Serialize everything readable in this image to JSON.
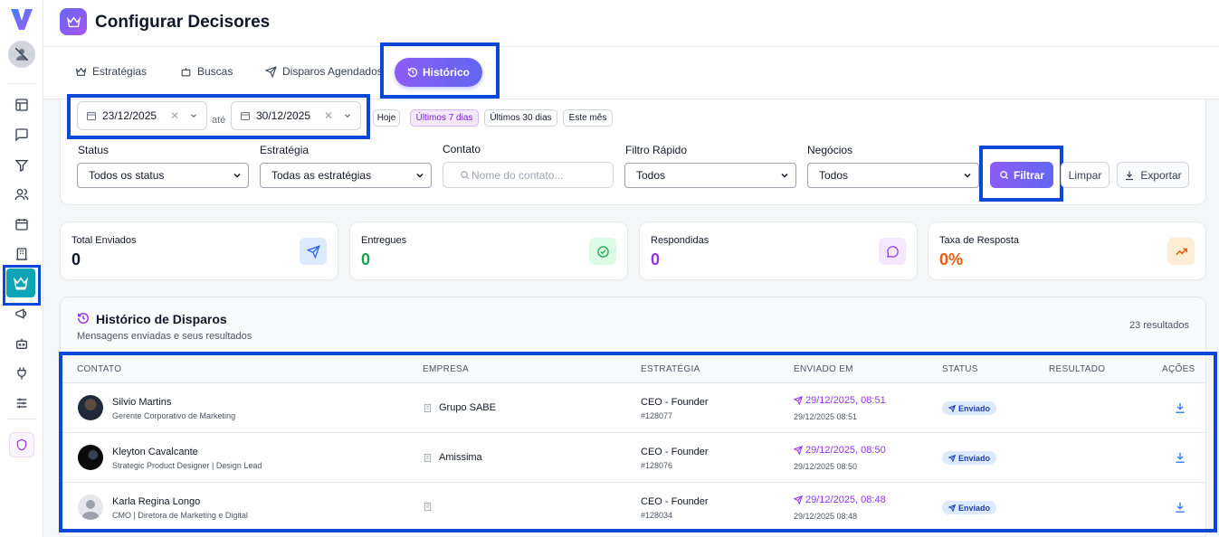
{
  "page": {
    "title": "Configurar Decisores"
  },
  "tabs": [
    {
      "label": "Estratégias",
      "icon": "crown-icon"
    },
    {
      "label": "Buscas",
      "icon": "robot-icon"
    },
    {
      "label": "Disparos Agendados",
      "icon": "send-icon"
    },
    {
      "label": "Histórico",
      "icon": "history-icon",
      "active": true
    }
  ],
  "filters": {
    "date_from": "23/12/2025",
    "date_to": "30/12/2025",
    "ate": "até",
    "quick": [
      "Hoje",
      "Últimos 7 dias",
      "Últimos 30 dias",
      "Este mês"
    ],
    "quick_selected": "Últimos 7 dias",
    "status": {
      "label": "Status",
      "value": "Todos os status"
    },
    "estrategia": {
      "label": "Estratégia",
      "value": "Todas as estratégias"
    },
    "contato": {
      "label": "Contato",
      "placeholder": "Nome do contato..."
    },
    "filtro_rapido": {
      "label": "Filtro Rápido",
      "value": "Todos"
    },
    "negocios": {
      "label": "Negócios",
      "value": "Todos"
    },
    "btn_filtrar": "Filtrar",
    "btn_limpar": "Limpar",
    "btn_exportar": "Exportar"
  },
  "stats": [
    {
      "label": "Total Enviados",
      "value": "0",
      "color": "#111827",
      "icon": "send-icon",
      "icon_bg": "#dbeafe",
      "icon_color": "#2563eb"
    },
    {
      "label": "Entregues",
      "value": "0",
      "color": "#16a34a",
      "icon": "check-circle-icon",
      "icon_bg": "#dcfce7",
      "icon_color": "#16a34a"
    },
    {
      "label": "Respondidas",
      "value": "0",
      "color": "#9333ea",
      "icon": "message-icon",
      "icon_bg": "#f3e8ff",
      "icon_color": "#9333ea"
    },
    {
      "label": "Taxa de Resposta",
      "value": "0%",
      "color": "#ea580c",
      "icon": "trending-up-icon",
      "icon_bg": "#ffedd5",
      "icon_color": "#ea580c"
    }
  ],
  "history": {
    "title": "Histórico de Disparos",
    "subtitle": "Mensagens enviadas e seus resultados",
    "count": "23 resultados",
    "columns": [
      "CONTATO",
      "EMPRESA",
      "ESTRATÉGIA",
      "ENVIADO EM",
      "STATUS",
      "RESULTADO",
      "AÇÕES"
    ],
    "rows": [
      {
        "name": "Silvio Martins",
        "role": "Gerente Corporativo de Marketing",
        "empresa": "Grupo SABE",
        "estrategia": "CEO - Founder",
        "estrategia_id": "#128077",
        "enviado": "29/12/2025, 08:51",
        "enviado_sub": "29/12/2025 08:51",
        "status": "Enviado",
        "avatar": "dark"
      },
      {
        "name": "Kleyton Cavalcante",
        "role": "Strategic Product Designer | Design Lead",
        "empresa": "Amissima",
        "estrategia": "CEO - Founder",
        "estrategia_id": "#128076",
        "enviado": "29/12/2025, 08:50",
        "enviado_sub": "29/12/2025 08:50",
        "status": "Enviado",
        "avatar": "black"
      },
      {
        "name": "Karla Regina Longo",
        "role": "CMO | Diretora de Marketing e Digital",
        "empresa": "",
        "estrategia": "CEO - Founder",
        "estrategia_id": "#128034",
        "enviado": "29/12/2025, 08:48",
        "enviado_sub": "29/12/2025 08:48",
        "status": "Enviado",
        "avatar": "placeholder"
      }
    ]
  }
}
